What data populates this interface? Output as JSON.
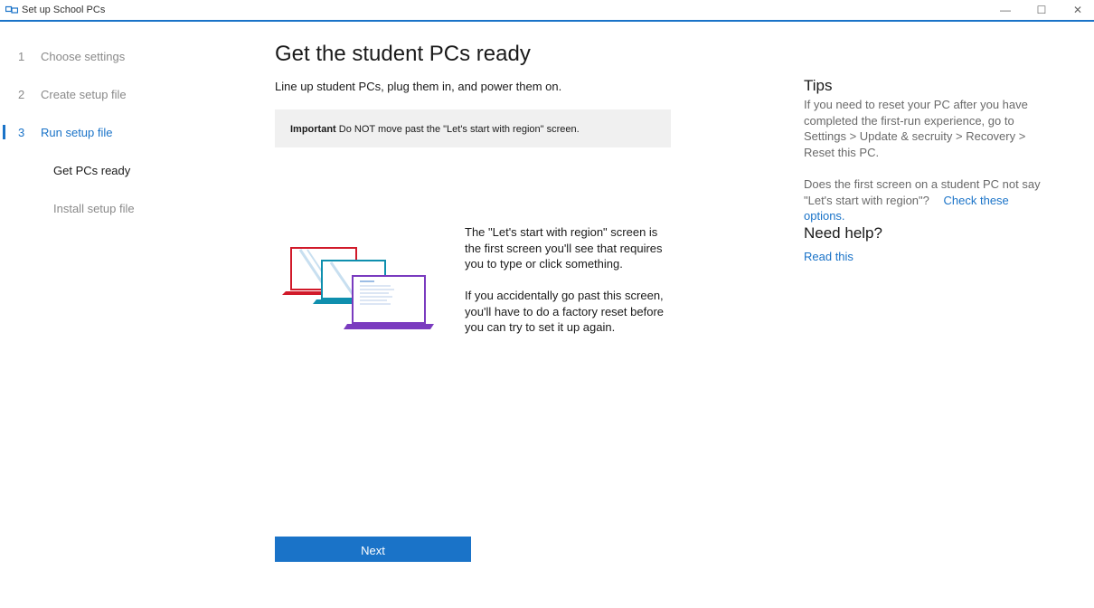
{
  "window": {
    "title": "Set up School PCs",
    "minimize_glyph": "—",
    "maximize_glyph": "☐",
    "close_glyph": "✕"
  },
  "nav": {
    "steps": [
      {
        "num": "1",
        "label": "Choose settings"
      },
      {
        "num": "2",
        "label": "Create setup file"
      },
      {
        "num": "3",
        "label": "Run setup file"
      }
    ],
    "substeps": [
      {
        "label": "Get PCs ready"
      },
      {
        "label": "Install setup file"
      }
    ]
  },
  "main": {
    "title": "Get the student PCs ready",
    "subtitle": "Line up student PCs, plug them in, and power them on.",
    "important_label": "Important",
    "important_text": " Do NOT move past the \"Let's start with region\" screen.",
    "desc_1": "The \"Let's start with region\" screen is the first screen you'll see that requires you to type or click something.",
    "desc_2": "If you accidentally go past this screen, you'll have to do a factory reset before you can try to set it up again.",
    "next_label": "Next"
  },
  "tips": {
    "title": "Tips",
    "text_1": "If you need to reset your PC after you have completed the first-run experience, go to Settings > Update & secruity > Recovery > Reset this PC.",
    "text_2": "Does the first screen on a student PC not say \"Let's start with region\"?",
    "link_check": "Check these options.",
    "help_title": "Need help?",
    "link_read": "Read this"
  },
  "colors": {
    "accent": "#1a73c8",
    "laptop_red": "#d11a2a",
    "laptop_teal": "#0f8fae",
    "laptop_purple": "#7a3bbf"
  },
  "icons": [
    "app-icon",
    "minimize-icon",
    "maximize-icon",
    "close-icon"
  ]
}
